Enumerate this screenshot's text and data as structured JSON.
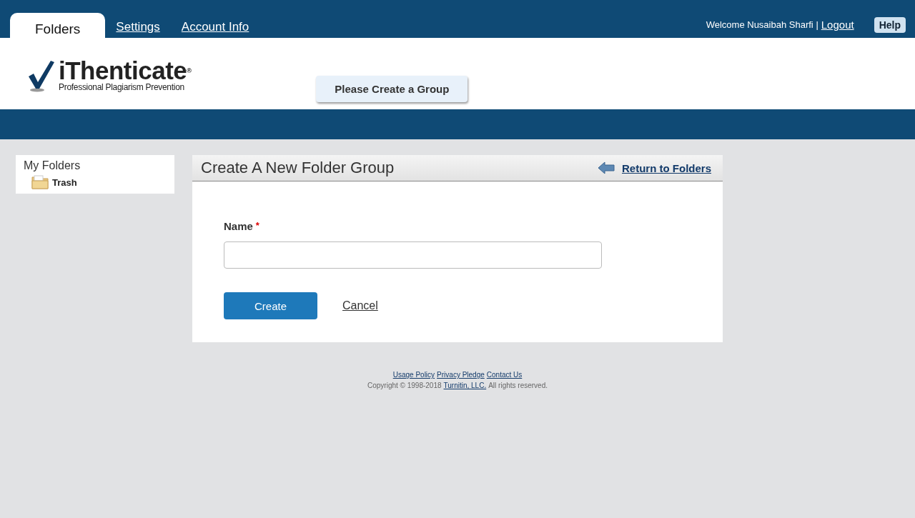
{
  "nav": {
    "tabs": [
      {
        "label": "Folders",
        "selected": true
      },
      {
        "label": "Settings",
        "selected": false
      },
      {
        "label": "Account Info",
        "selected": false
      }
    ],
    "welcome": "Welcome Nusaibah Sharfi",
    "separator": "|",
    "logout": "Logout",
    "help": "Help"
  },
  "header": {
    "logo": "iThenticate$^{®}$",
    "tagline": "Professional Plagiarism Prevention",
    "group_button": "Please Create a Group"
  },
  "sidebar": {
    "title": "My Folders",
    "items": [
      {
        "label": "Trash"
      }
    ]
  },
  "panel": {
    "title": "Create A New Folder Group",
    "return_link": "Return to Folders",
    "field": {
      "label": "Name",
      "required": true,
      "required_mark": "*"
    },
    "create": "Create",
    "cancel": "Cancel"
  },
  "footer": {
    "links": [
      "Usage Policy",
      "Privacy Pledge",
      "Contact Us"
    ],
    "copyright": "Copyright © 1998-2018",
    "company": "Turnitin, LLC.",
    "rights": "All rights reserved."
  }
}
